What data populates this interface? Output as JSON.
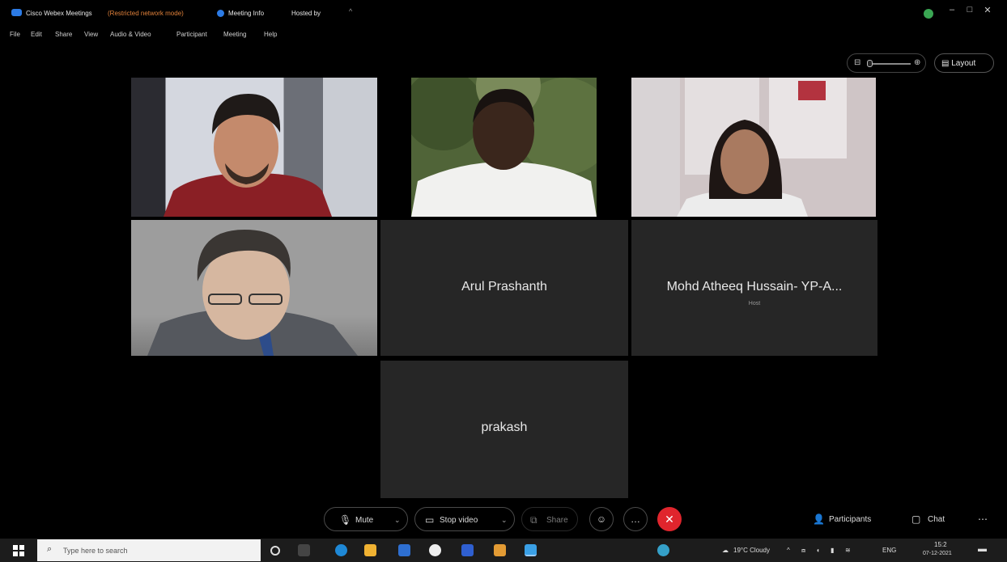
{
  "titlebar": {
    "app_title": "Cisco Webex Meetings",
    "app_subtitle": "(Restricted network mode)",
    "meeting_info": "Meeting Info",
    "host": "Hosted by"
  },
  "menubar": {
    "items": [
      "File",
      "Edit",
      "Share",
      "View",
      "Audio & Video",
      "Participant",
      "Meeting",
      "Help"
    ]
  },
  "view": {
    "layout_label": "Layout"
  },
  "tiles": {
    "arul": {
      "name": "Arul Prashanth"
    },
    "mohd": {
      "name": "Mohd Atheeq Hussain- YP-A...",
      "sub": "Host"
    },
    "prakash": {
      "name": "prakash"
    }
  },
  "controls": {
    "mute_label": "Mute",
    "video_label": "Stop video",
    "share_label": "Share",
    "participants_label": "Participants",
    "chat_label": "Chat"
  },
  "taskbar": {
    "search_placeholder": "Type here to search",
    "weather": "19°C Cloudy",
    "language": "ENG",
    "time": "15:2",
    "date": "07-12-2021"
  },
  "colors": {
    "end_button": "#e0252d",
    "status_dot": "#3aa653",
    "accent": "#2c7be5"
  }
}
